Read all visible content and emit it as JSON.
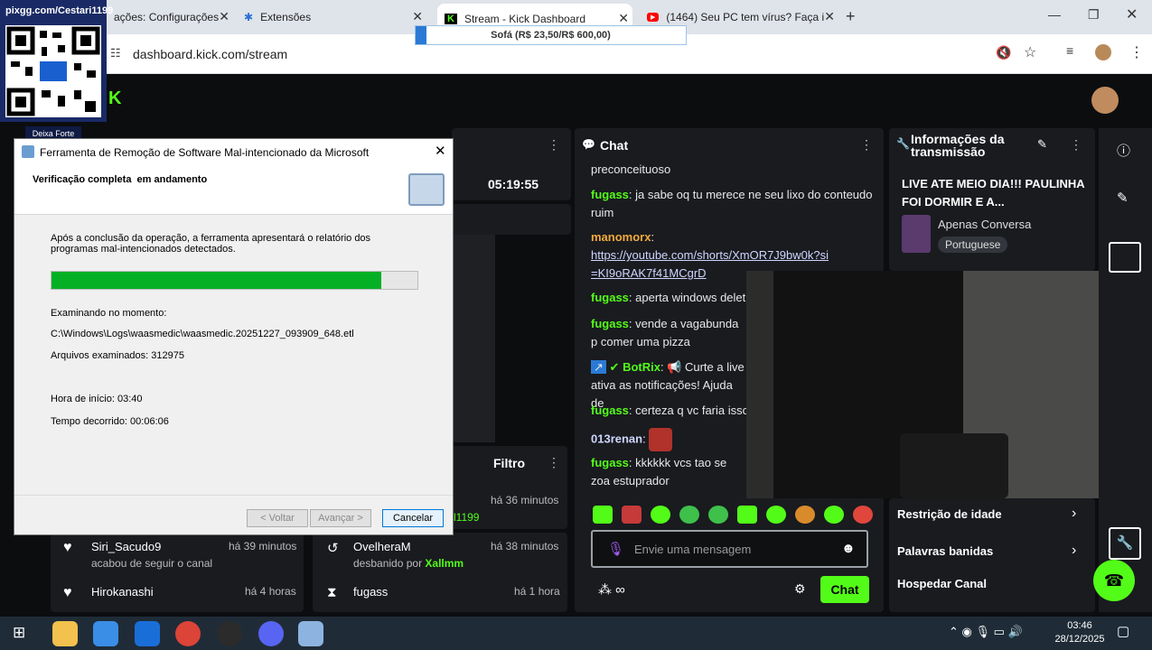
{
  "qr": {
    "label": "pixgg.com/Cestari1199",
    "tag": "Deixa Forte"
  },
  "browser": {
    "tabs": [
      {
        "title": "ações: Configurações"
      },
      {
        "title": "Extensões"
      },
      {
        "title": "Stream - Kick Dashboard"
      },
      {
        "title": "(1464) Seu PC tem vírus? Faça i"
      }
    ],
    "new_tab": "+",
    "url": "dashboard.kick.com/stream",
    "donation_goal": "Sofá (R$ 23,50/R$ 600,00)",
    "donation_progress": 0.039
  },
  "stream": {
    "uptime": "05:19:55",
    "filter_label": "Filtro"
  },
  "chat": {
    "title": "Chat",
    "messages": [
      {
        "user": "",
        "text": "preconceituoso"
      },
      {
        "user": "fugass",
        "text": "ja sabe oq tu merece ne seu lixo do conteudo ruim"
      },
      {
        "user": "manomorx",
        "text": "https://youtube.com/shorts/XmOR7J9bw0k?si=KI9oRAK7f41MCgrD"
      },
      {
        "user": "fugass",
        "text": "aperta windows delet"
      },
      {
        "user": "fugass",
        "text": "vende a vagabunda p comer uma pizza"
      },
      {
        "user": "BotRix",
        "text": "Curte a live ativa as notificações! Ajuda de"
      },
      {
        "user": "fugass",
        "text": "certeza q vc faria isso"
      },
      {
        "user": "013renan",
        "text": ""
      },
      {
        "user": "fugass",
        "text": "kkkkkk vcs tao se zoa estuprador"
      }
    ],
    "input_placeholder": "Envie uma mensagem",
    "send_label": "Chat"
  },
  "info": {
    "title": "Informações da transmissão",
    "stream_title": "LIVE ATE MEIO DIA!!! PAULINHA FOI DORMIR E A...",
    "category": "Apenas Conversa",
    "language": "Portuguese"
  },
  "settings": {
    "items": [
      "Restrição de idade",
      "Palavras banidas",
      "Hospedar Canal"
    ]
  },
  "activity": {
    "follows": [
      {
        "user": "Siri_Sacudo9",
        "action": "acabou de seguir o canal",
        "time": "há 39 minutos"
      },
      {
        "user": "Hirokanashi",
        "action": "",
        "time": "há 4 horas"
      }
    ],
    "mod": [
      {
        "user": "rl1199",
        "action": "",
        "time": "há 36 minutos"
      },
      {
        "user": "OvelheraM",
        "action": "desbanido por",
        "by": "Xallmm",
        "time": "há 38 minutos"
      },
      {
        "user": "fugass",
        "action": "",
        "time": "há 1 hora"
      }
    ]
  },
  "dialog": {
    "title": "Ferramenta de Remoção de Software Mal-intencionado da Microsoft",
    "heading": "Verificação completa  em andamento",
    "description": "Após a conclusão da operação, a ferramenta apresentará o relatório dos programas mal-intencionados detectados.",
    "progress": 0.9,
    "scanning_label": "Examinando no momento:",
    "scanning_path": "C:\\Windows\\Logs\\waasmedic\\waasmedic.20251227_093909_648.etl",
    "files_scanned": "Arquivos examinados: 312975",
    "start_time": "Hora de início: 03:40",
    "elapsed": "Tempo decorrido: 00:06:06",
    "btn_back": "< Voltar",
    "btn_next": "Avançar >",
    "btn_cancel": "Cancelar"
  },
  "taskbar": {
    "time": "03:46",
    "date": "28/12/2025"
  }
}
